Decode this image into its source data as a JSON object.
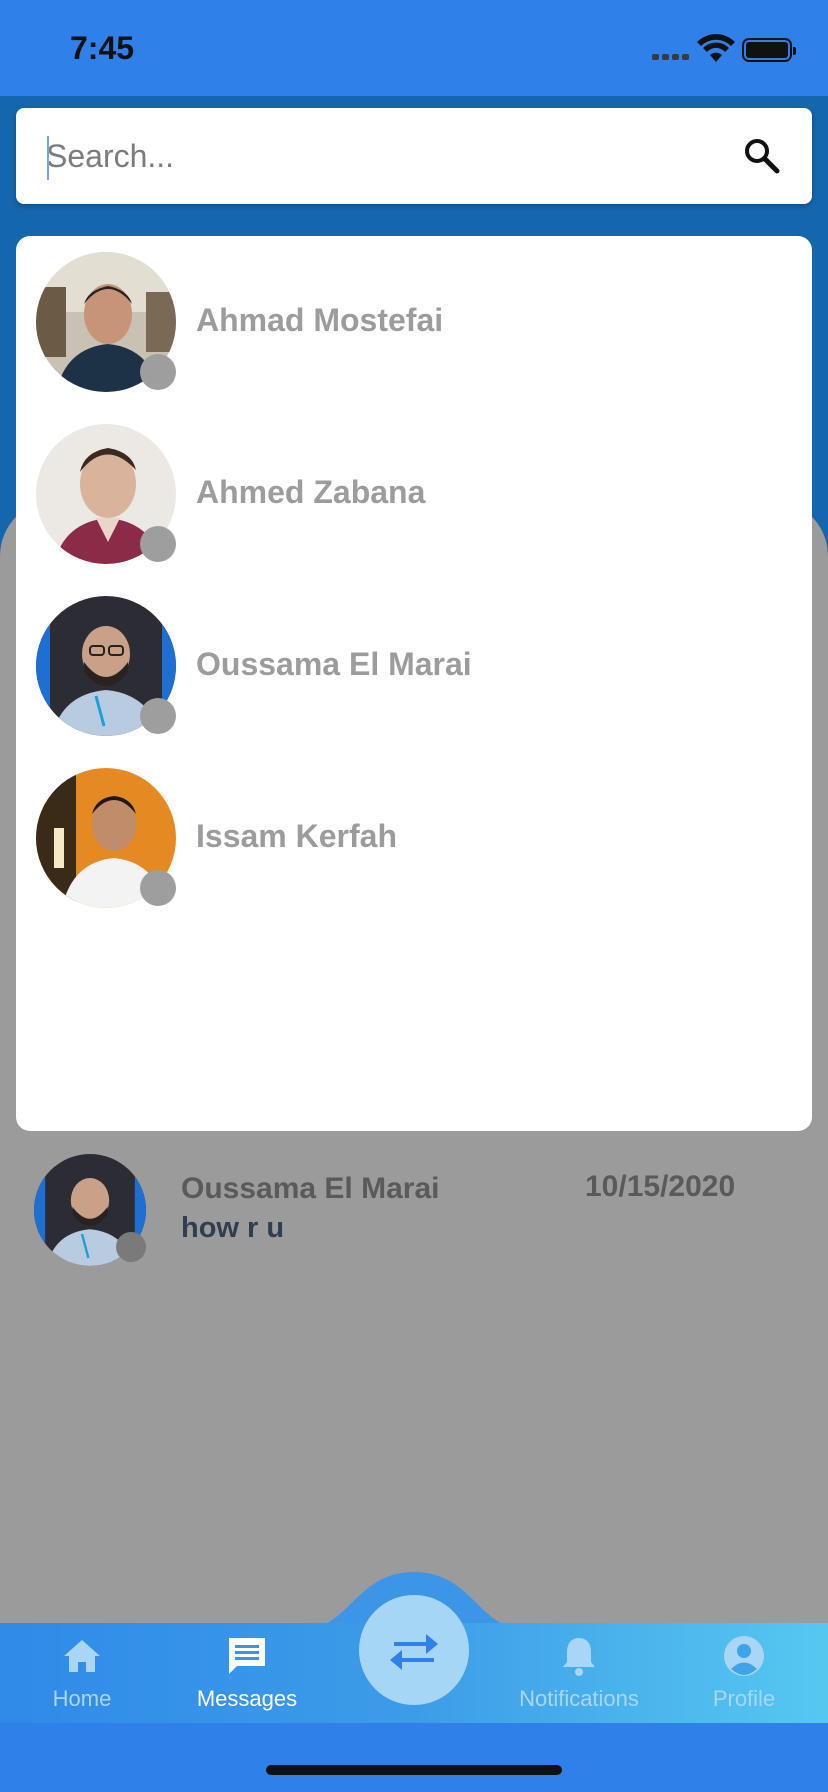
{
  "status_bar": {
    "time": "7:45"
  },
  "search": {
    "placeholder": "Search..."
  },
  "search_results": [
    {
      "name": "Ahmad Mostefai",
      "avatar_icon": "avatar-photo"
    },
    {
      "name": "Ahmed Zabana",
      "avatar_icon": "avatar-photo"
    },
    {
      "name": "Oussama El Marai",
      "avatar_icon": "avatar-photo"
    },
    {
      "name": "Issam Kerfah",
      "avatar_icon": "avatar-photo"
    }
  ],
  "conversation": {
    "name": "Oussama El Marai",
    "preview": "how r u",
    "date": "10/15/2020"
  },
  "nav": {
    "home": "Home",
    "messages": "Messages",
    "notifications": "Notifications",
    "profile": "Profile",
    "active": "messages"
  },
  "colors": {
    "primary": "#2f80e8",
    "header": "#1567ad",
    "overlay": "#9b9b9b",
    "fab": "#a5d6f6"
  }
}
